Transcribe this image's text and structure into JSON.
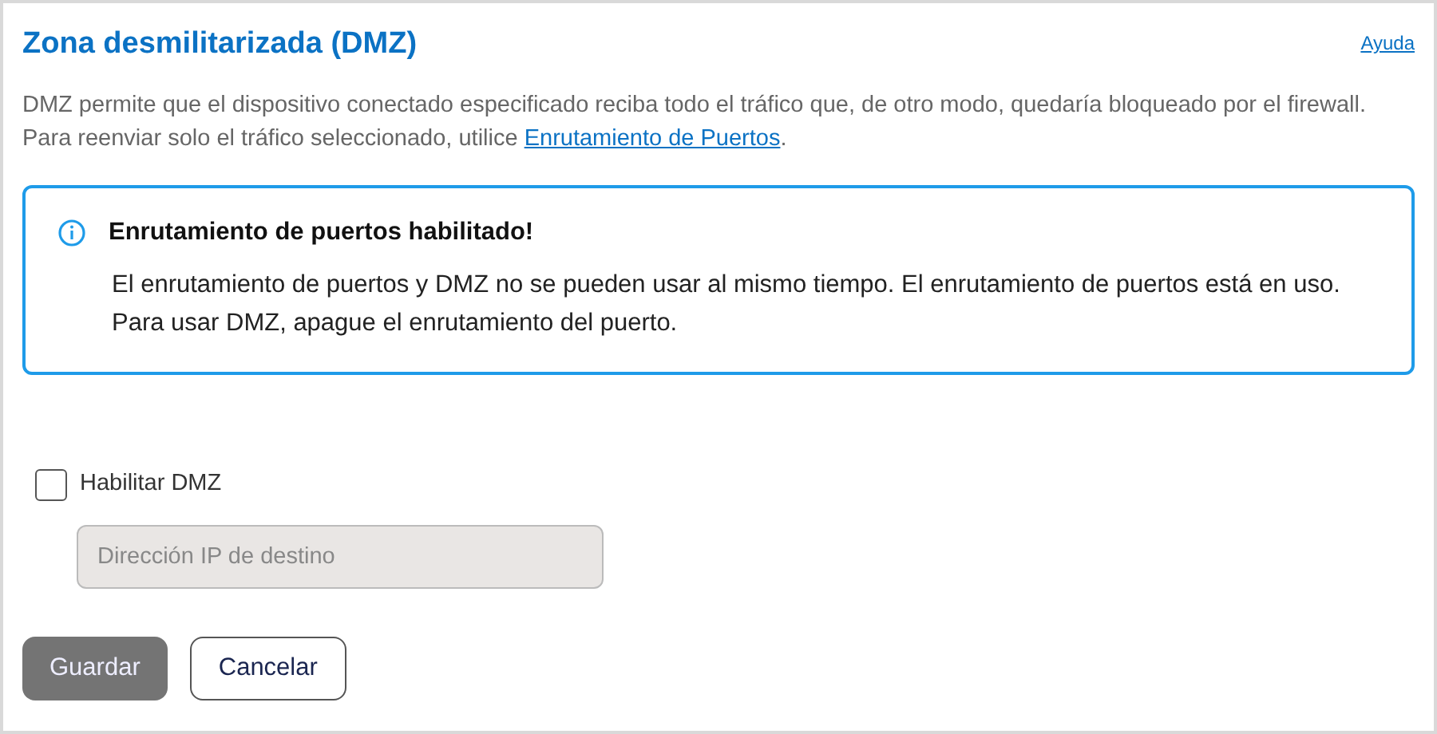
{
  "title": "Zona desmilitarizada (DMZ)",
  "help_link": "Ayuda",
  "description": {
    "before": "DMZ permite que el dispositivo conectado especificado reciba todo el tráfico que, de otro modo, quedaría bloqueado por el firewall. Para reenviar solo el tráfico seleccionado, utilice ",
    "link": "Enrutamiento de Puertos",
    "after": "."
  },
  "alert": {
    "title": "Enrutamiento de puertos habilitado!",
    "message": "El enrutamiento de puertos y DMZ no se pueden usar al mismo tiempo. El enrutamiento de puertos está en uso. Para usar DMZ, apague el enrutamiento del puerto."
  },
  "enable_checkbox": {
    "label": "Habilitar DMZ",
    "checked": false
  },
  "ip_field": {
    "placeholder": "Dirección IP de destino",
    "disabled": true
  },
  "buttons": [
    {
      "label": "Guardar",
      "kind": "primary",
      "disabled": true
    },
    {
      "label": "Cancelar",
      "kind": "secondary",
      "disabled": false
    }
  ]
}
